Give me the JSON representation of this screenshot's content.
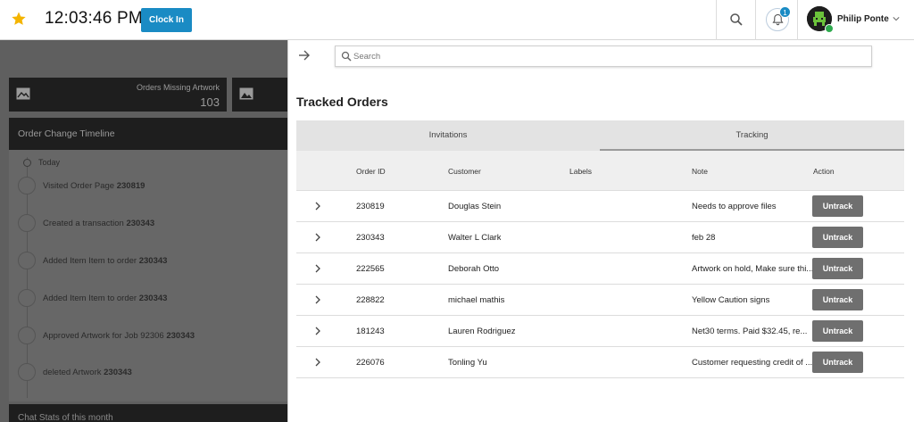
{
  "header": {
    "clock": "12:03:46 PM",
    "clock_in_label": "Clock In",
    "notification_count": "1",
    "user_name": "Philip Ponte"
  },
  "background": {
    "card_title": "Orders Missing Artwork",
    "card_value": "103",
    "timeline_title": "Order Change Timeline",
    "today_label": "Today",
    "timeline_items": [
      {
        "text": "Visited Order Page",
        "ref": "230819"
      },
      {
        "text": "Created a transaction",
        "ref": "230343"
      },
      {
        "text": "Added Item Item to order",
        "ref": "230343"
      },
      {
        "text": "Added Item Item to order",
        "ref": "230343"
      },
      {
        "text": "Approved Artwork for Job 92306",
        "ref": "230343"
      },
      {
        "text": "deleted Artwork",
        "ref": "230343"
      }
    ],
    "chat_title": "Chat Stats of this month"
  },
  "drawer": {
    "search_placeholder": "Search",
    "title": "Tracked Orders",
    "tabs": [
      {
        "label": "Invitations"
      },
      {
        "label": "Tracking",
        "active": true
      }
    ],
    "columns": [
      "Order ID",
      "Customer",
      "Labels",
      "Note",
      "Action"
    ],
    "rows": [
      {
        "order_id": "230819",
        "customer": "Douglas Stein",
        "labels": "",
        "note": "Needs to approve files",
        "action": "Untrack"
      },
      {
        "order_id": "230343",
        "customer": "Walter L Clark",
        "labels": "",
        "note": "feb 28",
        "action": "Untrack"
      },
      {
        "order_id": "222565",
        "customer": "Deborah Otto",
        "labels": "",
        "note": "Artwork on hold, Make sure thi...",
        "action": "Untrack"
      },
      {
        "order_id": "228822",
        "customer": "michael mathis",
        "labels": "",
        "note": "Yellow Caution signs",
        "action": "Untrack"
      },
      {
        "order_id": "181243",
        "customer": "Lauren Rodriguez",
        "labels": "",
        "note": "Net30 terms. Paid $32.45, re...",
        "action": "Untrack"
      },
      {
        "order_id": "226076",
        "customer": "Tonling Yu",
        "labels": "",
        "note": "Customer requesting credit of ...",
        "action": "Untrack"
      }
    ]
  },
  "colors": {
    "accent": "#1a8bc4",
    "star": "#f4b400",
    "untrack_button": "#6f6f6f",
    "online": "#2eaa4e"
  },
  "icons": [
    "star-icon",
    "search-icon",
    "bell-icon",
    "chevron-down-icon",
    "arrow-right-icon",
    "image-icon",
    "chevron-right-icon"
  ]
}
